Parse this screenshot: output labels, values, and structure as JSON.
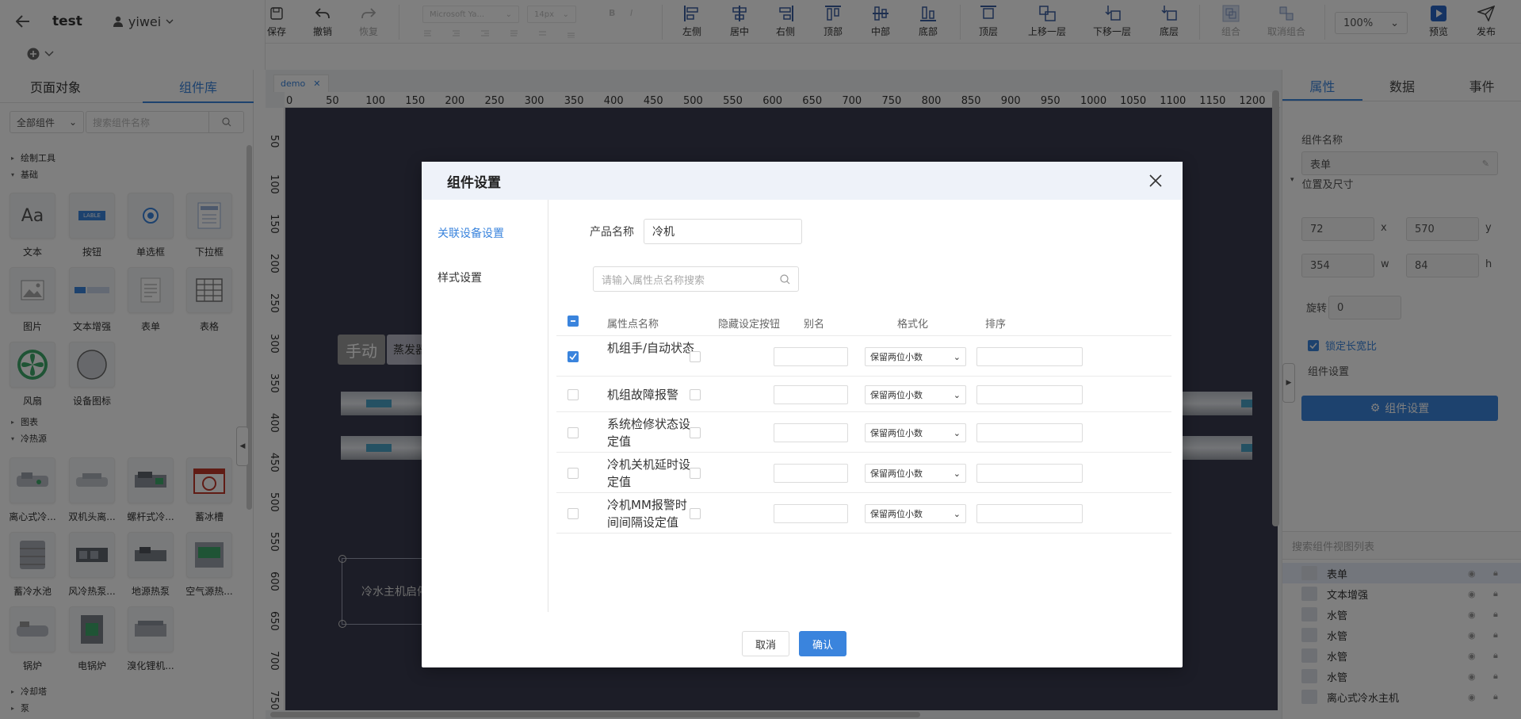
{
  "header": {
    "app_name": "test",
    "user": "yiwei"
  },
  "toolbar": {
    "save": "保存",
    "undo": "撤销",
    "redo": "恢复",
    "font_family": "Microsoft Ya...",
    "font_size": "14px",
    "align_left": "左侧",
    "align_center": "居中",
    "align_right": "右侧",
    "align_top": "顶部",
    "align_middle": "中部",
    "align_bottom": "底部",
    "layer_top": "顶层",
    "layer_up": "上移一层",
    "layer_down": "下移一层",
    "layer_bottom": "底层",
    "group": "组合",
    "ungroup": "取消组合",
    "zoom": "100%",
    "preview": "预览",
    "publish": "发布"
  },
  "left_panel": {
    "tabs": [
      "页面对象",
      "组件库"
    ],
    "filter_select": "全部组件",
    "search_placeholder": "搜索组件名称",
    "categories": {
      "drawing": "绘制工具",
      "basic": "基础",
      "charts": "图表",
      "heat_source": "冷热源",
      "cooling_tower": "冷却塔",
      "pump": "泵"
    },
    "basic_items": [
      "文本",
      "按钮",
      "单选框",
      "下拉框",
      "图片",
      "文本增强",
      "表单",
      "表格",
      "风扇",
      "设备图标"
    ],
    "heat_items": [
      "离心式冷...",
      "双机头离...",
      "螺杆式冷...",
      "蓄冰槽",
      "蓄冷水池",
      "风冷热泵...",
      "地源热泵",
      "空气源热...",
      "锅炉",
      "电锅炉",
      "溴化锂机..."
    ],
    "button_thumb_text": "LABLE"
  },
  "canvas": {
    "tab": "demo",
    "ruler_h": [
      "0",
      "50",
      "100",
      "150",
      "200",
      "250",
      "300",
      "350",
      "400",
      "450",
      "500",
      "550",
      "600",
      "650",
      "700",
      "750",
      "800",
      "850",
      "900",
      "950",
      "1000",
      "1050",
      "1100",
      "1150",
      "1200"
    ],
    "ruler_v": [
      "50",
      "100",
      "150",
      "200",
      "250",
      "300",
      "350",
      "400",
      "450",
      "500",
      "550",
      "600",
      "650",
      "700",
      "750"
    ],
    "manual_label": "手动",
    "evap_label": "蒸发器",
    "chiller_text": "冷水主机启停"
  },
  "right_panel": {
    "tabs": [
      "属性",
      "数据",
      "事件"
    ],
    "comp_name_label": "组件名称",
    "comp_name": "表单",
    "pos_section": "位置及尺寸",
    "x": "72",
    "y": "570",
    "w": "354",
    "h": "84",
    "x_label": "x",
    "y_label": "y",
    "w_label": "w",
    "h_label": "h",
    "rotate_label": "旋转",
    "rotate": "0",
    "lock_ratio": "锁定长宽比",
    "comp_setting_label": "组件设置",
    "comp_setting_btn": "组件设置",
    "list_search_placeholder": "搜索组件视图列表",
    "layers": [
      "表单",
      "文本增强",
      "水管",
      "水管",
      "水管",
      "水管",
      "离心式冷水主机"
    ]
  },
  "modal": {
    "title": "组件设置",
    "nav": [
      "关联设备设置",
      "样式设置"
    ],
    "product_label": "产品名称",
    "product_value": "冷机",
    "search_placeholder": "请输入属性点名称搜索",
    "columns": [
      "属性点名称",
      "隐藏设定按钮",
      "别名",
      "格式化",
      "排序"
    ],
    "rows": [
      {
        "name": "机组手/自动状态",
        "checked": true,
        "format": "保留两位小数"
      },
      {
        "name": "机组故障报警",
        "checked": false,
        "format": "保留两位小数"
      },
      {
        "name": "系统检修状态设定值",
        "checked": false,
        "format": "保留两位小数"
      },
      {
        "name": "冷机关机延时设定值",
        "checked": false,
        "format": "保留两位小数"
      },
      {
        "name": "冷机MM报警时间间隔设定值",
        "checked": false,
        "format": "保留两位小数"
      }
    ],
    "cancel": "取消",
    "confirm": "确认"
  },
  "colors": {
    "accent": "#3a84dd",
    "canvas_bg": "#393b4e"
  }
}
